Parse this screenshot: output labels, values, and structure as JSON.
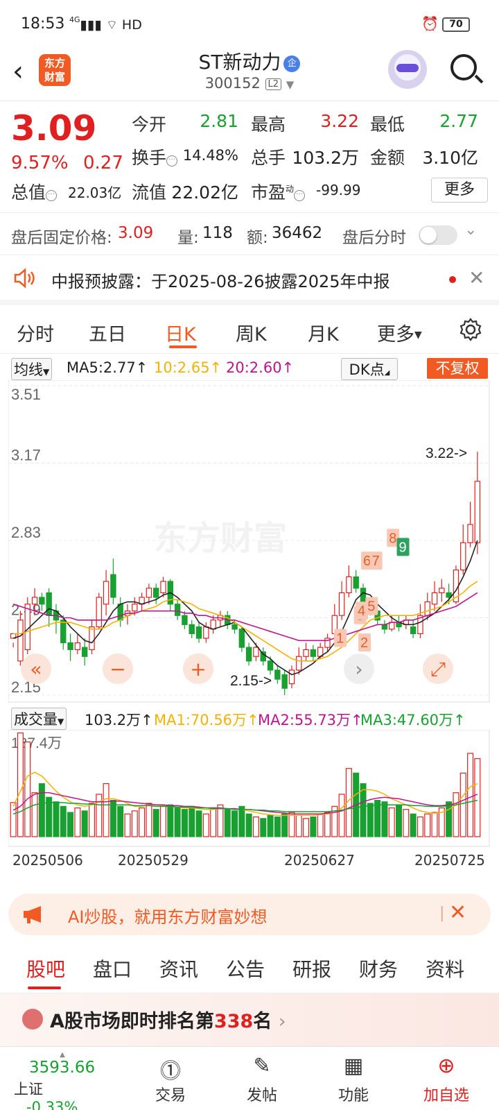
{
  "status_bar": {
    "time": "18:53",
    "signal": "4G",
    "network": "HD",
    "battery": "70"
  },
  "header": {
    "logo_line1": "东方",
    "logo_line2": "财富",
    "stock_name": "ST新动力",
    "badge": "企",
    "stock_code": "300152",
    "level": "L2"
  },
  "quote": {
    "price": "3.09",
    "change_pct": "9.57%",
    "change": "0.27",
    "open_label": "今开",
    "open": "2.81",
    "high_label": "最高",
    "high": "3.22",
    "low_label": "最低",
    "low": "2.77",
    "turnover_label": "换手",
    "turnover": "14.48%",
    "volume_label": "总手",
    "volume": "103.2万",
    "amount_label": "金额",
    "amount": "3.10亿",
    "mktcap_label": "总值",
    "mktcap": "22.03亿",
    "float_label": "流值",
    "float": "22.02亿",
    "pe_label": "市盈",
    "pe_sup": "动",
    "pe": "-99.99",
    "more_label": "更多"
  },
  "after_hours": {
    "price_label": "盘后固定价格:",
    "price": "3.09",
    "vol_label": "量:",
    "vol": "118",
    "amt_label": "额:",
    "amt": "36462",
    "timeshare_label": "盘后分时"
  },
  "notice": {
    "text": "中报预披露：于2025-08-26披露2025年中报"
  },
  "period_tabs": [
    "分时",
    "五日",
    "日K",
    "周K",
    "月K",
    "更多"
  ],
  "ma_legend": {
    "selector": "均线",
    "ma5": "MA5:2.77↑",
    "ma10": "10:2.65↑",
    "ma20": "20:2.60↑",
    "dk": "DK点",
    "adjust": "不复权"
  },
  "colors": {
    "up": "#e02020",
    "down": "#18a030",
    "ma5": "#222222",
    "ma10": "#f0b400",
    "ma20": "#c0148c",
    "accent": "#f15a22"
  },
  "chart_data": [
    {
      "type": "candlestick",
      "y_ticks": [
        "3.51",
        "3.17",
        "2.83",
        "2.49",
        "2.15"
      ],
      "ylim": [
        2.15,
        3.51
      ],
      "max_label": "3.22->",
      "min_label": "2.15->",
      "watermark": "东方财富",
      "pattern_markers": [
        "1",
        "2",
        "3",
        "4",
        "5",
        "6",
        "7",
        "8",
        "9"
      ],
      "candles": [
        [
          2.4,
          2.42,
          2.38,
          2.36
        ],
        [
          2.3,
          2.48,
          2.52,
          2.28
        ],
        [
          2.35,
          2.55,
          2.58,
          2.33
        ],
        [
          2.55,
          2.58,
          2.62,
          2.5
        ],
        [
          2.58,
          2.55,
          2.6,
          2.52
        ],
        [
          2.6,
          2.5,
          2.62,
          2.45
        ],
        [
          2.52,
          2.48,
          2.55,
          2.42
        ],
        [
          2.48,
          2.38,
          2.5,
          2.35
        ],
        [
          2.38,
          2.35,
          2.42,
          2.3
        ],
        [
          2.35,
          2.38,
          2.42,
          2.33
        ],
        [
          2.36,
          2.32,
          2.4,
          2.28
        ],
        [
          2.35,
          2.45,
          2.48,
          2.33
        ],
        [
          2.45,
          2.58,
          2.6,
          2.44
        ],
        [
          2.55,
          2.65,
          2.7,
          2.5
        ],
        [
          2.68,
          2.58,
          2.75,
          2.55
        ],
        [
          2.55,
          2.48,
          2.58,
          2.45
        ],
        [
          2.5,
          2.52,
          2.55,
          2.46
        ],
        [
          2.52,
          2.55,
          2.58,
          2.5
        ],
        [
          2.55,
          2.58,
          2.6,
          2.52
        ],
        [
          2.58,
          2.62,
          2.64,
          2.55
        ],
        [
          2.62,
          2.58,
          2.64,
          2.55
        ],
        [
          2.6,
          2.65,
          2.67,
          2.58
        ],
        [
          2.65,
          2.55,
          2.66,
          2.52
        ],
        [
          2.55,
          2.5,
          2.57,
          2.48
        ],
        [
          2.5,
          2.46,
          2.52,
          2.44
        ],
        [
          2.46,
          2.42,
          2.48,
          2.4
        ],
        [
          2.45,
          2.4,
          2.47,
          2.38
        ],
        [
          2.4,
          2.45,
          2.47,
          2.38
        ],
        [
          2.44,
          2.48,
          2.5,
          2.42
        ],
        [
          2.48,
          2.5,
          2.52,
          2.45
        ],
        [
          2.5,
          2.46,
          2.52,
          2.44
        ],
        [
          2.46,
          2.44,
          2.48,
          2.42
        ],
        [
          2.44,
          2.36,
          2.45,
          2.34
        ],
        [
          2.36,
          2.3,
          2.38,
          2.28
        ],
        [
          2.32,
          2.36,
          2.38,
          2.3
        ],
        [
          2.34,
          2.3,
          2.36,
          2.28
        ],
        [
          2.3,
          2.26,
          2.32,
          2.24
        ],
        [
          2.26,
          2.22,
          2.28,
          2.2
        ],
        [
          2.24,
          2.18,
          2.26,
          2.15
        ],
        [
          2.2,
          2.26,
          2.28,
          2.18
        ],
        [
          2.26,
          2.32,
          2.36,
          2.24
        ],
        [
          2.32,
          2.35,
          2.38,
          2.3
        ],
        [
          2.35,
          2.32,
          2.37,
          2.3
        ],
        [
          2.32,
          2.36,
          2.38,
          2.31
        ],
        [
          2.36,
          2.4,
          2.42,
          2.34
        ],
        [
          2.42,
          2.5,
          2.55,
          2.4
        ],
        [
          2.5,
          2.6,
          2.65,
          2.48
        ],
        [
          2.6,
          2.67,
          2.72,
          2.58
        ],
        [
          2.67,
          2.62,
          2.7,
          2.6
        ],
        [
          2.62,
          2.55,
          2.64,
          2.52
        ],
        [
          2.55,
          2.52,
          2.58,
          2.5
        ],
        [
          2.52,
          2.48,
          2.54,
          2.46
        ],
        [
          2.46,
          2.44,
          2.48,
          2.42
        ],
        [
          2.44,
          2.47,
          2.5,
          2.43
        ],
        [
          2.47,
          2.45,
          2.5,
          2.43
        ],
        [
          2.46,
          2.48,
          2.5,
          2.44
        ],
        [
          2.45,
          2.42,
          2.48,
          2.4
        ],
        [
          2.42,
          2.5,
          2.55,
          2.4
        ],
        [
          2.5,
          2.56,
          2.6,
          2.48
        ],
        [
          2.55,
          2.6,
          2.65,
          2.52
        ],
        [
          2.6,
          2.62,
          2.66,
          2.56
        ],
        [
          2.6,
          2.58,
          2.64,
          2.55
        ],
        [
          2.56,
          2.7,
          2.72,
          2.55
        ],
        [
          2.7,
          2.82,
          2.9,
          2.68
        ],
        [
          2.82,
          2.9,
          3.0,
          2.8
        ],
        [
          2.82,
          3.09,
          3.22,
          2.77
        ]
      ],
      "ma5": [
        2.4,
        2.41,
        2.44,
        2.47,
        2.5,
        2.53,
        2.52,
        2.49,
        2.45,
        2.42,
        2.39,
        2.38,
        2.42,
        2.47,
        2.52,
        2.55,
        2.56,
        2.56,
        2.55,
        2.56,
        2.57,
        2.59,
        2.6,
        2.58,
        2.55,
        2.52,
        2.47,
        2.45,
        2.44,
        2.45,
        2.46,
        2.47,
        2.45,
        2.41,
        2.37,
        2.33,
        2.31,
        2.28,
        2.26,
        2.24,
        2.25,
        2.27,
        2.29,
        2.32,
        2.34,
        2.38,
        2.43,
        2.5,
        2.57,
        2.6,
        2.59,
        2.55,
        2.52,
        2.49,
        2.47,
        2.46,
        2.46,
        2.47,
        2.49,
        2.51,
        2.54,
        2.57,
        2.61,
        2.67,
        2.74,
        2.83
      ],
      "ma10": [
        2.42,
        2.42,
        2.43,
        2.44,
        2.45,
        2.46,
        2.47,
        2.47,
        2.47,
        2.46,
        2.45,
        2.44,
        2.44,
        2.45,
        2.47,
        2.48,
        2.5,
        2.51,
        2.52,
        2.53,
        2.54,
        2.56,
        2.57,
        2.57,
        2.56,
        2.55,
        2.53,
        2.52,
        2.51,
        2.5,
        2.49,
        2.47,
        2.45,
        2.43,
        2.41,
        2.39,
        2.37,
        2.35,
        2.33,
        2.31,
        2.3,
        2.3,
        2.3,
        2.31,
        2.32,
        2.34,
        2.36,
        2.39,
        2.42,
        2.45,
        2.48,
        2.49,
        2.5,
        2.5,
        2.5,
        2.5,
        2.5,
        2.51,
        2.52,
        2.53,
        2.54,
        2.56,
        2.58,
        2.6,
        2.63,
        2.65
      ],
      "ma20": [
        2.55,
        2.54,
        2.53,
        2.52,
        2.51,
        2.5,
        2.5,
        2.49,
        2.49,
        2.48,
        2.48,
        2.48,
        2.48,
        2.48,
        2.49,
        2.5,
        2.51,
        2.51,
        2.52,
        2.52,
        2.52,
        2.52,
        2.52,
        2.52,
        2.51,
        2.51,
        2.5,
        2.5,
        2.49,
        2.49,
        2.48,
        2.48,
        2.47,
        2.46,
        2.45,
        2.44,
        2.43,
        2.42,
        2.41,
        2.4,
        2.39,
        2.39,
        2.39,
        2.39,
        2.39,
        2.4,
        2.41,
        2.42,
        2.43,
        2.44,
        2.45,
        2.46,
        2.46,
        2.47,
        2.47,
        2.48,
        2.48,
        2.49,
        2.5,
        2.51,
        2.52,
        2.53,
        2.54,
        2.56,
        2.58,
        2.6
      ]
    },
    {
      "type": "bar",
      "title": "成交量",
      "y_max_label": "137.4万",
      "ylim": [
        0,
        137.4
      ],
      "legend": {
        "total": "103.2万↑",
        "ma1": "MA1:70.56万↑",
        "ma2": "MA2:55.73万↑",
        "ma3": "MA3:47.60万↑"
      },
      "x_tick_labels": [
        "20250506",
        "20250529",
        "20250627",
        "20250725"
      ],
      "volumes": [
        45,
        137,
        125,
        58,
        70,
        52,
        46,
        40,
        32,
        38,
        34,
        44,
        56,
        70,
        48,
        40,
        30,
        34,
        38,
        44,
        36,
        40,
        42,
        38,
        36,
        40,
        34,
        30,
        38,
        42,
        36,
        34,
        40,
        30,
        26,
        24,
        28,
        26,
        30,
        32,
        28,
        24,
        26,
        30,
        32,
        40,
        56,
        90,
        84,
        70,
        44,
        48,
        46,
        38,
        42,
        36,
        30,
        26,
        30,
        32,
        38,
        46,
        58,
        84,
        110,
        103
      ],
      "ma1": [
        40,
        60,
        80,
        85,
        80,
        70,
        60,
        52,
        46,
        42,
        40,
        42,
        46,
        50,
        50,
        48,
        44,
        40,
        40,
        42,
        42,
        41,
        40,
        39,
        38,
        38,
        37,
        36,
        36,
        37,
        37,
        36,
        36,
        34,
        32,
        30,
        29,
        28,
        28,
        28,
        28,
        28,
        28,
        29,
        30,
        32,
        38,
        48,
        56,
        62,
        62,
        60,
        56,
        50,
        46,
        42,
        38,
        34,
        32,
        31,
        32,
        36,
        42,
        54,
        66,
        70
      ],
      "ma2": [
        35,
        40,
        50,
        56,
        58,
        58,
        56,
        54,
        52,
        50,
        48,
        46,
        46,
        46,
        47,
        47,
        46,
        45,
        44,
        43,
        42,
        42,
        41,
        41,
        40,
        40,
        39,
        38,
        38,
        38,
        37,
        37,
        36,
        36,
        35,
        34,
        33,
        32,
        31,
        30,
        30,
        30,
        30,
        30,
        31,
        32,
        34,
        38,
        42,
        46,
        49,
        51,
        52,
        51,
        50,
        48,
        46,
        44,
        42,
        41,
        41,
        42,
        44,
        48,
        52,
        56
      ],
      "ma3": [
        30,
        33,
        38,
        42,
        44,
        45,
        45,
        45,
        44,
        44,
        43,
        43,
        42,
        42,
        42,
        42,
        42,
        41,
        41,
        41,
        40,
        40,
        40,
        39,
        39,
        39,
        38,
        38,
        37,
        37,
        37,
        36,
        36,
        36,
        35,
        35,
        34,
        34,
        33,
        33,
        33,
        33,
        33,
        33,
        33,
        34,
        35,
        37,
        38,
        40,
        41,
        42,
        42,
        42,
        42,
        42,
        41,
        41,
        40,
        40,
        40,
        41,
        42,
        44,
        46,
        48
      ]
    }
  ],
  "ai_banner": {
    "text": "AI炒股，就用东方财富妙想"
  },
  "bottom_tabs": [
    "股吧",
    "盘口",
    "资讯",
    "公告",
    "研报",
    "财务",
    "资料"
  ],
  "ranking": {
    "prefix": "A股市场即时排名第",
    "rank": "338",
    "suffix": "名"
  },
  "bottom_nav": {
    "index_value": "3593.66",
    "index_name": "上证",
    "index_change": "-0.33%",
    "items": [
      "交易",
      "发帖",
      "功能",
      "加自选"
    ]
  }
}
